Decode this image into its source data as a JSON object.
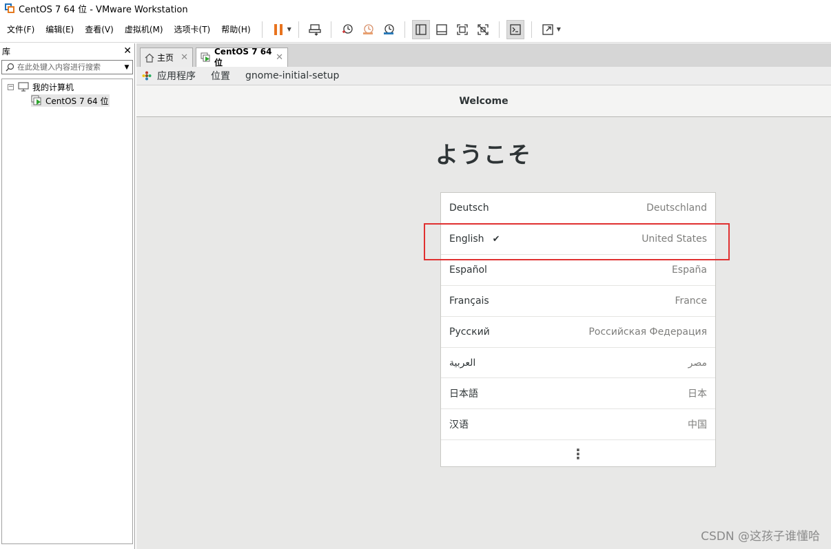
{
  "window": {
    "title": "CentOS 7 64 位 - VMware Workstation"
  },
  "menu": {
    "items": [
      "文件(F)",
      "编辑(E)",
      "查看(V)",
      "虚拟机(M)",
      "选项卡(T)",
      "帮助(H)"
    ]
  },
  "toolbar": {
    "buttons": [
      "pause-icon",
      "send-keys-icon",
      "snapshot-icon",
      "revert-snapshot-icon",
      "snapshot-manager-icon",
      "library-view-icon",
      "thumbnail-bar-icon",
      "fullscreen-icon",
      "unity-icon",
      "console-icon",
      "stretch-icon"
    ],
    "accent_color": "#e8731e"
  },
  "library": {
    "title": "库",
    "close": "✕",
    "search_placeholder": "在此处键入内容进行搜索",
    "tree": {
      "root": "我的计算机",
      "vm": "CentOS 7 64 位"
    }
  },
  "tabs": [
    {
      "label": "主页"
    },
    {
      "label": "CentOS 7 64 位"
    }
  ],
  "guest": {
    "topbar": {
      "applications": "应用程序",
      "places": "位置",
      "app_name": "gnome-initial-setup"
    },
    "header_title": "Welcome",
    "heading": "ようこそ",
    "languages": [
      {
        "name": "Deutsch",
        "region": "Deutschland",
        "selected": false
      },
      {
        "name": "English",
        "region": "United States",
        "selected": true
      },
      {
        "name": "Español",
        "region": "España",
        "selected": false
      },
      {
        "name": "Français",
        "region": "France",
        "selected": false
      },
      {
        "name": "Русский",
        "region": "Российская Федерация",
        "selected": false
      },
      {
        "name": "العربية",
        "region": "مصر",
        "selected": false
      },
      {
        "name": "日本語",
        "region": "日本",
        "selected": false
      },
      {
        "name": "汉语",
        "region": "中国",
        "selected": false
      }
    ],
    "check_mark": "✔",
    "more": "⋮"
  },
  "watermark": "CSDN @这孩子谁懂哈",
  "highlight_color": "#e03030"
}
